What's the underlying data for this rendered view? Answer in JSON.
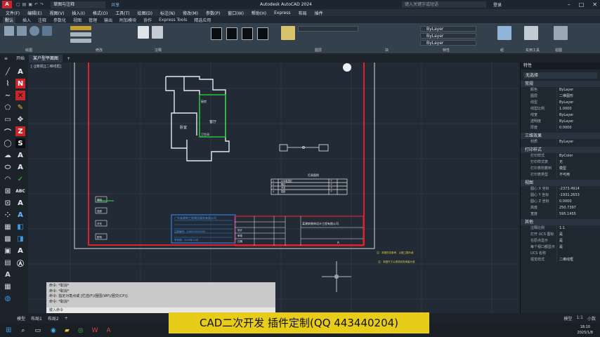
{
  "titlebar": {
    "doc_selector": "草图与注释",
    "share": "共享",
    "app_title": "Autodesk AutoCAD 2024",
    "search_placeholder": "键入关键字或短语",
    "user": "登录"
  },
  "menus": [
    "文件(F)",
    "编辑(E)",
    "视图(V)",
    "插入(I)",
    "格式(O)",
    "工具(T)",
    "绘图(D)",
    "标注(N)",
    "修改(M)",
    "参数(P)",
    "窗口(W)",
    "帮助(H)",
    "Express",
    "布局",
    "插件"
  ],
  "ribbon_tabs": [
    "默认",
    "插入",
    "注释",
    "参数化",
    "视图",
    "管理",
    "输出",
    "附加模块",
    "协作",
    "Express Tools",
    "精选应用"
  ],
  "ribbon_panels": {
    "draw": "绘图",
    "modify": "修改",
    "annotation": "注释",
    "layers": "图层",
    "block": "块",
    "properties": "特性",
    "groups": "组",
    "utilities": "实用工具",
    "view": "视图"
  },
  "layer_dropdowns": [
    "ByLayer",
    "ByLayer",
    "ByLayer"
  ],
  "doc_tabs": [
    "开始",
    "某户型平面图"
  ],
  "viewport_label": "[-][俯视][二维线框]",
  "drawing": {
    "room1": "卧室",
    "room2": "客厅",
    "room3": "厨房",
    "room4": "卫生间",
    "legend_title": "灯具图例",
    "legend_rows": [
      [
        "1",
        "LED吸顶灯",
        "个"
      ],
      [
        "2",
        "筒灯",
        "个"
      ],
      [
        "3",
        "开关",
        "个"
      ],
      [
        "4",
        "插座",
        "个"
      ]
    ],
    "blue_block": [
      "广东省建筑工程建设服务有限公司",
      "注册编号：440000000000",
      "有效期：2025年12月"
    ],
    "title_block": {
      "company": "某建筑装饰设计工程有限公司",
      "rows": [
        "设计",
        "审核",
        "日期"
      ],
      "sheet": "A"
    },
    "legend_items": [
      "照明",
      "插座",
      "开关",
      "配电"
    ]
  },
  "notes": [
    "注：本图仅供参考，以施工图为准",
    "注：本图尺寸以现场实际测量为准"
  ],
  "properties": {
    "title": "特性",
    "selection": "无选择",
    "sections": [
      {
        "name": "常规",
        "rows": [
          [
            "颜色",
            "ByLayer"
          ],
          [
            "图层",
            "二维图形"
          ],
          [
            "线型",
            "ByLayer"
          ],
          [
            "线型比例",
            "1.0000"
          ],
          [
            "线宽",
            "ByLayer"
          ],
          [
            "透明度",
            "ByLayer"
          ],
          [
            "厚度",
            "0.0000"
          ]
        ]
      },
      {
        "name": "三维效果",
        "rows": [
          [
            "材质",
            "ByLayer"
          ]
        ]
      },
      {
        "name": "打印样式",
        "rows": [
          [
            "打印样式",
            "ByColor"
          ],
          [
            "打印样式表",
            "无"
          ],
          [
            "打印表附着到",
            "模型"
          ],
          [
            "打印表类型",
            "不可用"
          ]
        ]
      },
      {
        "name": "视图",
        "rows": [
          [
            "圆心 X 坐标",
            "-2373.4914"
          ],
          [
            "圆心 Y 坐标",
            "-1931.2653"
          ],
          [
            "圆心 Z 坐标",
            "0.0000"
          ],
          [
            "高度",
            "250.7397"
          ],
          [
            "宽度",
            "595.1455"
          ]
        ]
      },
      {
        "name": "其他",
        "rows": [
          [
            "注释比例",
            "1:1"
          ],
          [
            "打开 UCS 图标",
            "是"
          ],
          [
            "在原点显示",
            "是"
          ],
          [
            "每个视口都显示",
            "是"
          ],
          [
            "UCS 名称",
            ""
          ],
          [
            "视觉样式",
            "二维线框"
          ]
        ]
      }
    ]
  },
  "command_lines": [
    "命令: *取消*",
    "命令: *取消*",
    "命令: 指定对角点或 [栏选(F)/圈围(WP)/圈交(CP)]:",
    "命令: *取消*",
    "命令: *取消*"
  ],
  "command_prompt": "键入命令",
  "layout_tabs": [
    "模型",
    "布局1",
    "布局2"
  ],
  "status": [
    "模型",
    "1:1",
    "小数"
  ],
  "banner": "CAD二次开发 插件定制(QQ 443440204)",
  "clock": {
    "time": "18:10",
    "date": "2025/1/8"
  },
  "colors": {
    "red": "#e0202a",
    "green": "#25c23a",
    "blue": "#2d7fe0",
    "accent": "#e8cc1a"
  }
}
